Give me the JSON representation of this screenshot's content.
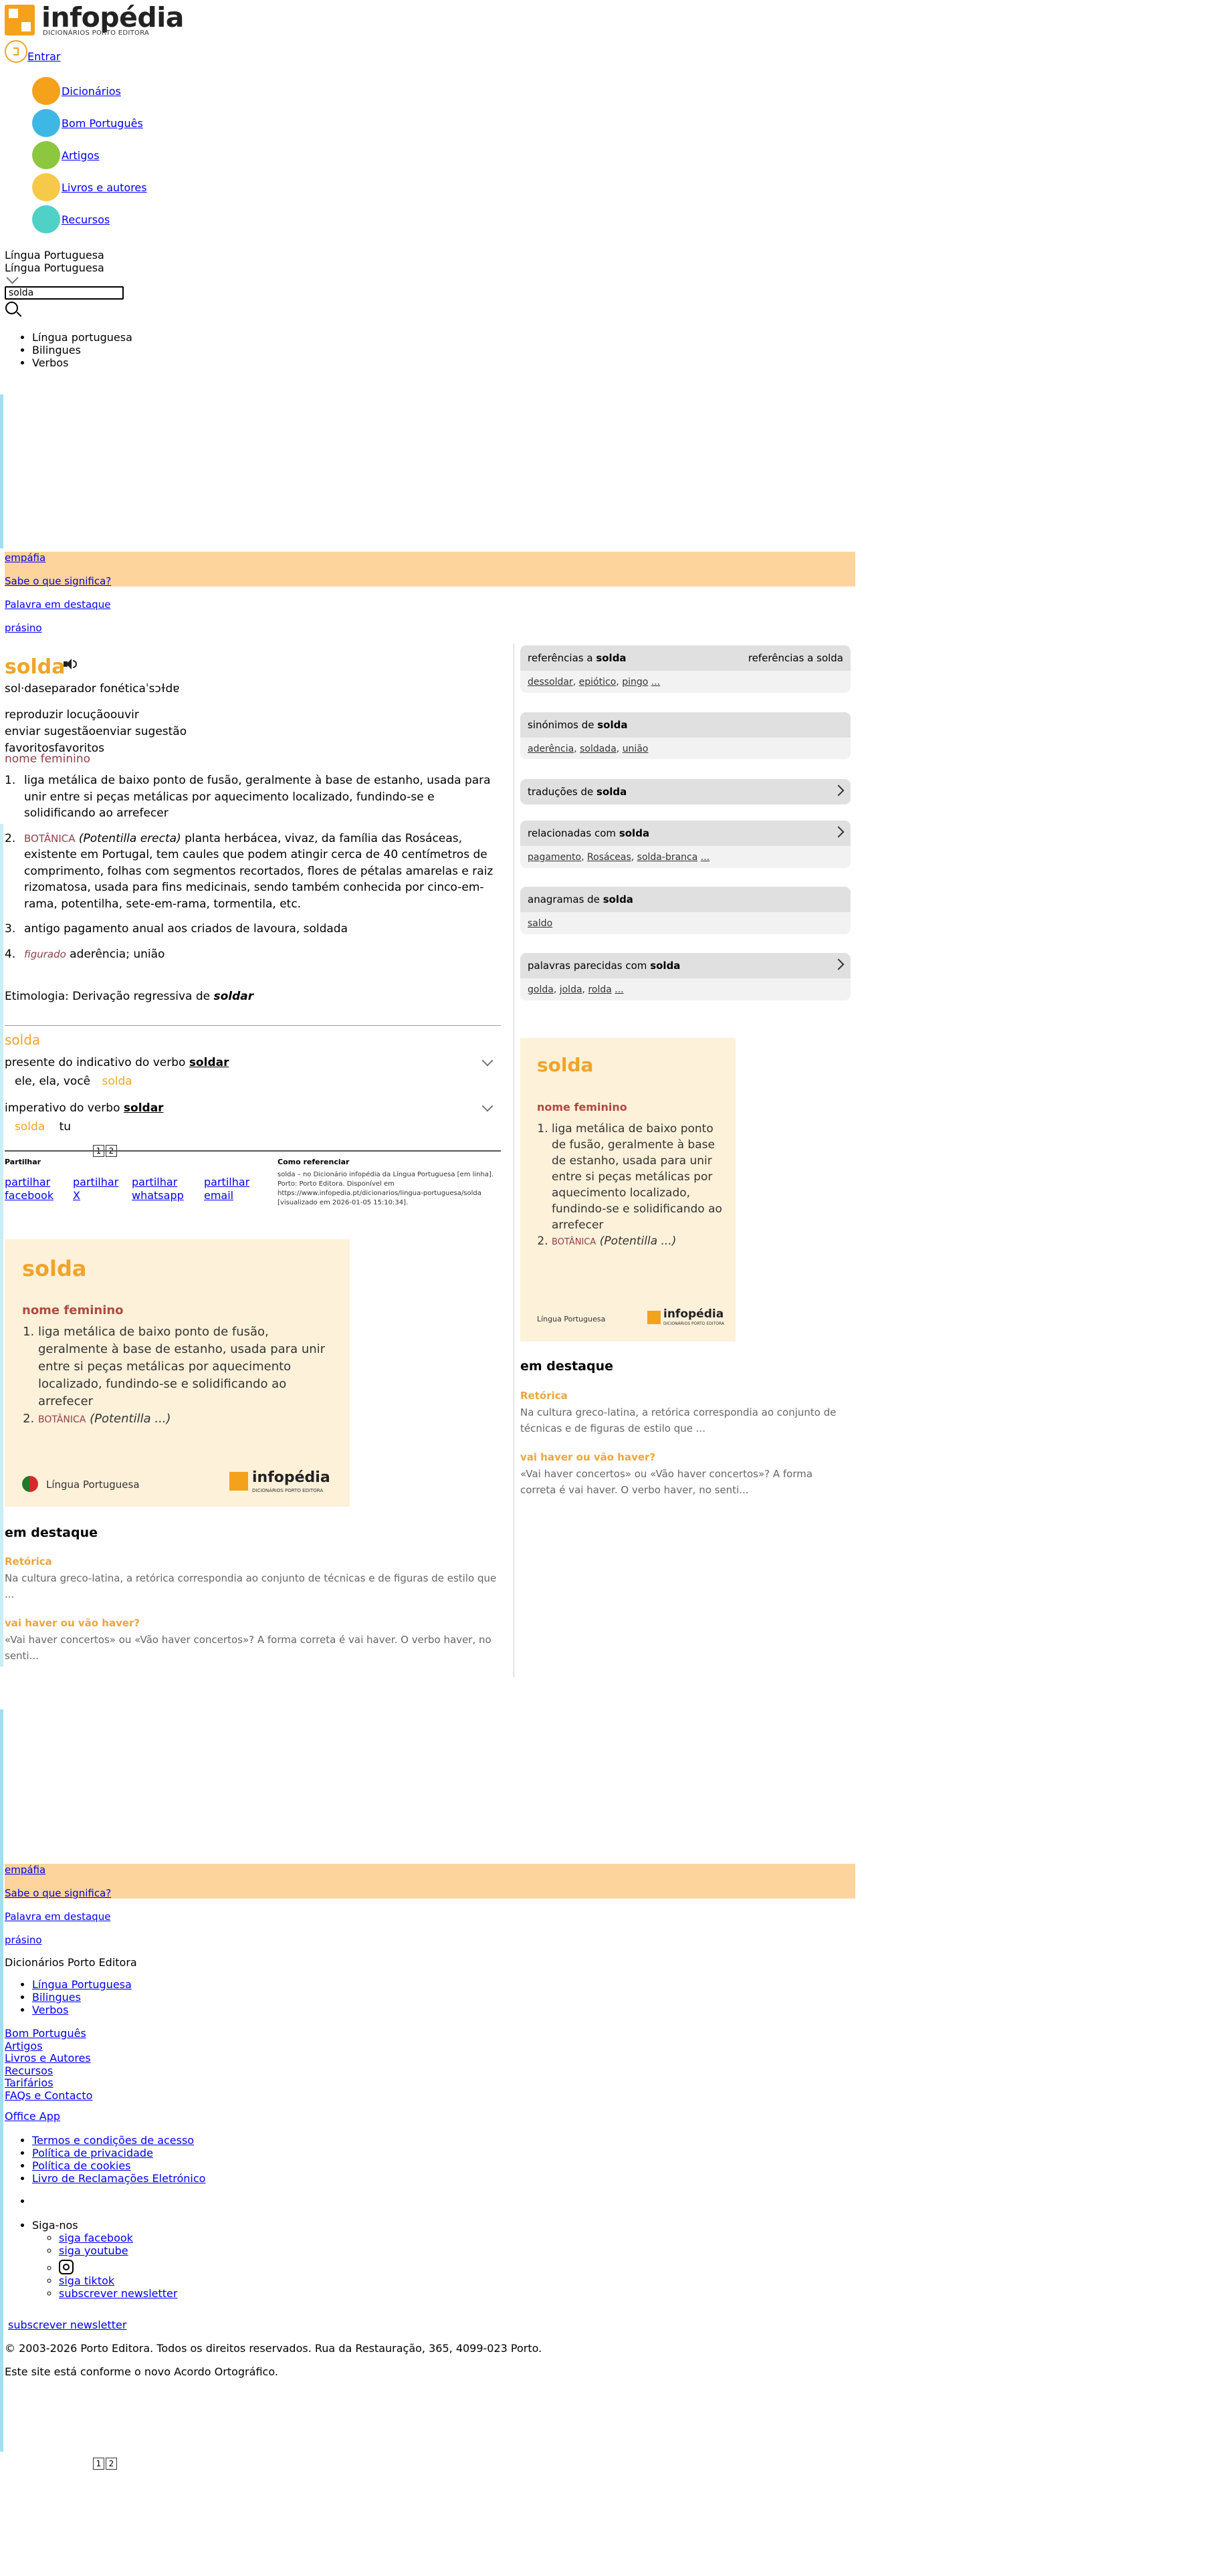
{
  "header": {
    "logo_name": "infopédia",
    "logo_sub": "DICIONÁRIOS PORTO EDITORA",
    "login": "Entrar"
  },
  "nav": [
    {
      "label": "Dicionários",
      "color": "#f4a11c"
    },
    {
      "label": "Bom Português",
      "color": "#3fb7e5"
    },
    {
      "label": "Artigos",
      "color": "#8dc63f"
    },
    {
      "label": "Livros e autores",
      "color": "#f7c948"
    },
    {
      "label": "Recursos",
      "color": "#4fd1c5"
    }
  ],
  "search": {
    "dict_selected": "Língua Portuguesa",
    "dict_selected_2": "Língua Portuguesa",
    "value": "solda",
    "options": [
      "Língua portuguesa",
      "Bilingues",
      "Verbos"
    ]
  },
  "banner": {
    "word": "empáfia",
    "question": "Sabe o que significa?",
    "featured": "Palavra em destaque",
    "next_word": "prásino"
  },
  "entry": {
    "word": "solda",
    "syllables": "sol·da",
    "sep_alt": "separador fonética",
    "phonetic": "ˈsɔɫdɐ",
    "play_alt": "reproduzir locução",
    "play": "ouvir",
    "suggest_alt": "enviar sugestão",
    "suggest": "enviar sugestão",
    "fav_alt": "favoritos",
    "fav": "favoritos",
    "category": "nome feminino",
    "senses": [
      {
        "n": "1.",
        "text": "liga metálica de baixo ponto de fusão, geralmente à base de estanho, usada para unir entre si peças metálicas por aquecimento localizado, fundindo-se e solidificando ao arrefecer"
      },
      {
        "n": "2.",
        "domain": "BOTÂNICA",
        "sci": "(Potentilla erecta)",
        "text": " planta herbácea, vivaz, da família das Rosáceas, existente em Portugal, tem caules que podem atingir cerca de 40 centímetros de comprimento, folhas com segmentos recortados, flores de pétalas amarelas e raiz rizomatosa, usada para fins medicinais, sendo também conhecida por cinco-em-rama, potentilha, sete-em-rama, tormentila, etc."
      },
      {
        "n": "3.",
        "text": "antigo pagamento anual aos criados de lavoura, soldada"
      },
      {
        "n": "4.",
        "domain": "figurado",
        "text": " aderência; união"
      }
    ],
    "etymology_prefix": "Etimologia: Derivação regressiva de ",
    "etymology_word": "soldar"
  },
  "verb": {
    "word": "solda",
    "row1_label": "presente do indicativo do verbo ",
    "row1_verb": "soldar",
    "row1_person": "ele, ela, você",
    "row1_form": "solda",
    "row2_label": "imperativo do verbo ",
    "row2_verb": "soldar",
    "row2_form": "solda",
    "row2_person": "tu"
  },
  "pager": [
    "1",
    "2"
  ],
  "share": {
    "title": "Partilhar",
    "links": [
      "partilhar facebook",
      "partilhar X",
      "partilhar whatsapp",
      "partilhar email"
    ],
    "cite_title": "Como referenciar",
    "cite_text": "solda – no Dicionário infopédia da Língua Portuguesa [em linha]. Porto: Porto Editora. Disponível em https://www.infopedia.pt/dicionarios/lingua-portuguesa/solda [visualizado em 2026-01-05 15:10:34]."
  },
  "card": {
    "word": "solda",
    "category": "nome feminino",
    "sense1": "liga metálica de baixo ponto de fusão, geralmente à base de estanho, usada para unir entre si peças metálicas por aquecimento localizado, fundindo-se e solidificando ao arrefecer",
    "sense2_domain": "BOTÂNICA",
    "sense2_text": "(Potentilla ...)",
    "footer": "Língua Portuguesa",
    "brand": "infopédia",
    "brand_sub": "DICIONÁRIOS PORTO EDITORA"
  },
  "featured": {
    "title": "em destaque",
    "items": [
      {
        "head": "Retórica",
        "text": "Na cultura greco-latina, a retórica correspondia ao conjunto de técnicas e de figuras de estilo que ..."
      },
      {
        "head": "vai haver ou vão haver?",
        "text": "«Vai haver concertos» ou «Vão haver concertos»? A forma correta é vai haver. O verbo haver, no senti..."
      }
    ]
  },
  "panels": {
    "references": {
      "prefix": "referências a ",
      "word": "solda",
      "img_alt": "referências a solda",
      "links": [
        "dessoldar",
        "epiótico",
        "pingo",
        "..."
      ]
    },
    "synonyms": {
      "prefix": "sinónimos de ",
      "word": "solda",
      "links": [
        "aderência",
        "soldada",
        "união"
      ]
    },
    "translations": {
      "prefix": "traduções de ",
      "word": "solda"
    },
    "related": {
      "prefix": "relacionadas com ",
      "word": "solda",
      "links": [
        "pagamento",
        "Rosáceas",
        "solda-branca",
        "..."
      ]
    },
    "anagrams": {
      "prefix": "anagramas de ",
      "word": "solda",
      "links": [
        "saldo"
      ]
    },
    "similar": {
      "prefix": "palavras parecidas com ",
      "word": "solda",
      "links": [
        "golda",
        "jolda",
        "rolda",
        "..."
      ]
    }
  },
  "footer": {
    "section_title": "Dicionários Porto Editora",
    "dict_links": [
      "Língua Portuguesa",
      "Bilingues",
      "Verbos"
    ],
    "links": [
      "Bom Português",
      "Artigos",
      "Livros e Autores",
      "Recursos",
      "Tarifários",
      "FAQs e Contacto"
    ],
    "office": "Office App",
    "legal": [
      "Termos e condições de acesso",
      "Política de privacidade",
      "Política de cookies",
      "Livro de Reclamações Eletrónico"
    ],
    "follow": "Siga-nos",
    "social": [
      "siga facebook",
      "siga youtube",
      "siga tiktok",
      "subscrever newsletter"
    ],
    "newsletter": "subscrever newsletter",
    "copyright": "© 2003-2026 Porto Editora. Todos os direitos reservados. Rua da Restauração, 365, 4099-023 Porto.",
    "ao": "Este site está conforme o novo Acordo Ortográfico."
  }
}
